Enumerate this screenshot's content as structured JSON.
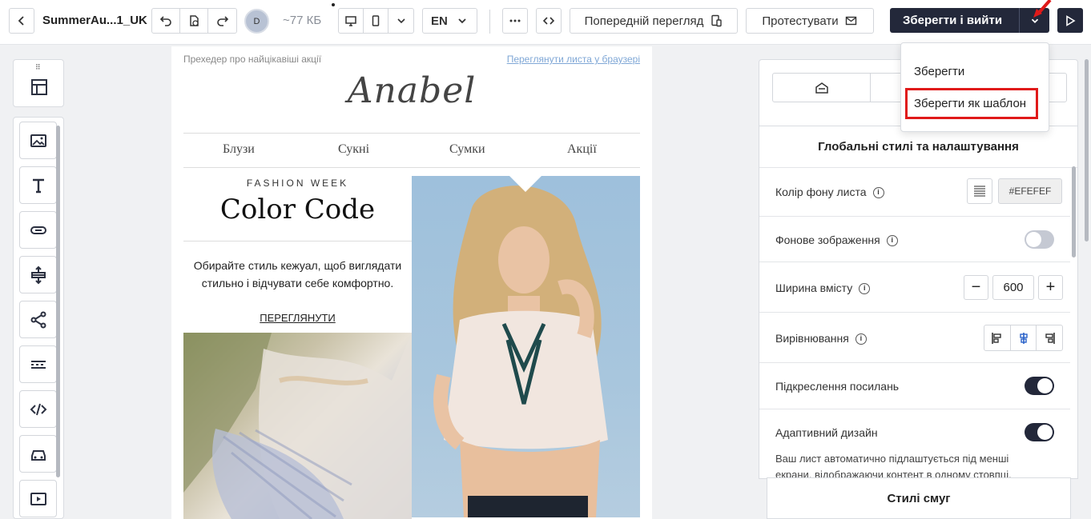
{
  "topbar": {
    "title": "SummerAu...1_UK",
    "avatar_initial": "D",
    "size": "~77 КБ",
    "language": "EN",
    "preview_label": "Попередній перегляд",
    "test_label": "Протестувати",
    "save_exit_label": "Зберегти і вийти"
  },
  "dropdown": {
    "items": [
      "Зберегти",
      "Зберегти як шаблон"
    ]
  },
  "email": {
    "preheader": "Прехедер про найцікавіші акції",
    "web_link": "Переглянути листа у браузері",
    "logo": "Anabel",
    "nav": [
      "Блузи",
      "Сукні",
      "Сумки",
      "Акції"
    ],
    "kicker": "FASHION WEEK",
    "headline": "Color Code",
    "description": "Обирайте стиль кежуал, щоб виглядати стильно і відчувати себе комфортно.",
    "cta": "ПЕРЕГЛЯНУТИ"
  },
  "settings": {
    "header": "Глобальні стилі та налаштування",
    "bg_color_label": "Колір фону листа",
    "bg_color_value": "#EFEFEF",
    "bg_image_label": "Фонове зображення",
    "bg_image_on": false,
    "width_label": "Ширина вмісту",
    "width_value": "600",
    "align_label": "Вирівнювання",
    "underline_label": "Підкреслення посилань",
    "underline_on": true,
    "adaptive_label": "Адаптивний дизайн",
    "adaptive_on": true,
    "adaptive_note": "Ваш лист автоматично підлаштується під менші екрани, відображаючи контент в одному стовпці.",
    "strip_styles_label": "Стилі смуг"
  },
  "colors": {
    "primary": "#23283a",
    "highlight": "#e01a1a",
    "toggle_on": "#23283a",
    "toggle_off": "#c5c9d3"
  }
}
